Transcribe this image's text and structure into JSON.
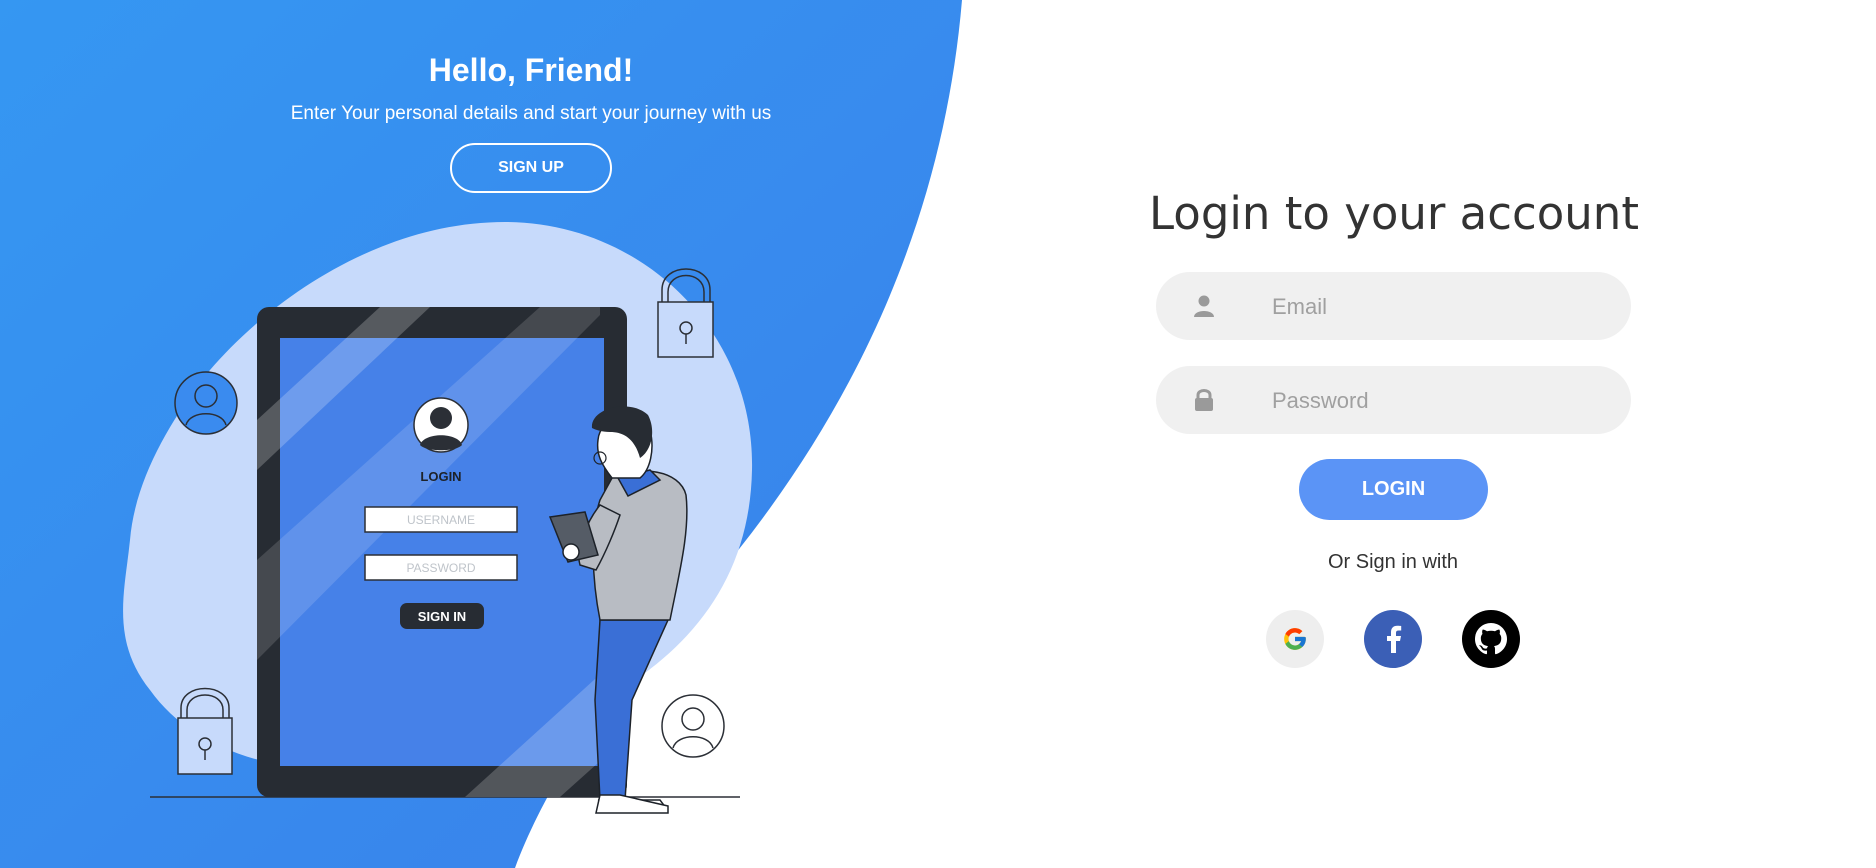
{
  "left": {
    "title": "Hello, Friend!",
    "subtitle": "Enter Your personal details and start your journey with us",
    "signup_label": "SIGN UP",
    "illustration": {
      "login_label": "LOGIN",
      "username_placeholder": "USERNAME",
      "password_placeholder": "PASSWORD",
      "signin_label": "SIGN IN"
    }
  },
  "login": {
    "title": "Login to your account",
    "email_placeholder": "Email",
    "password_placeholder": "Password",
    "button_label": "LOGIN",
    "alt_text": "Or Sign in with"
  },
  "icons": {
    "email": "user-icon",
    "password": "lock-icon",
    "google": "google-icon",
    "facebook": "facebook-icon",
    "github": "github-icon"
  },
  "colors": {
    "primary_blue": "#3a8bef",
    "button_blue": "#5b94f6",
    "blob": "#c7dafb",
    "screen": "#4681e8",
    "facebook": "#3b5fb6"
  }
}
